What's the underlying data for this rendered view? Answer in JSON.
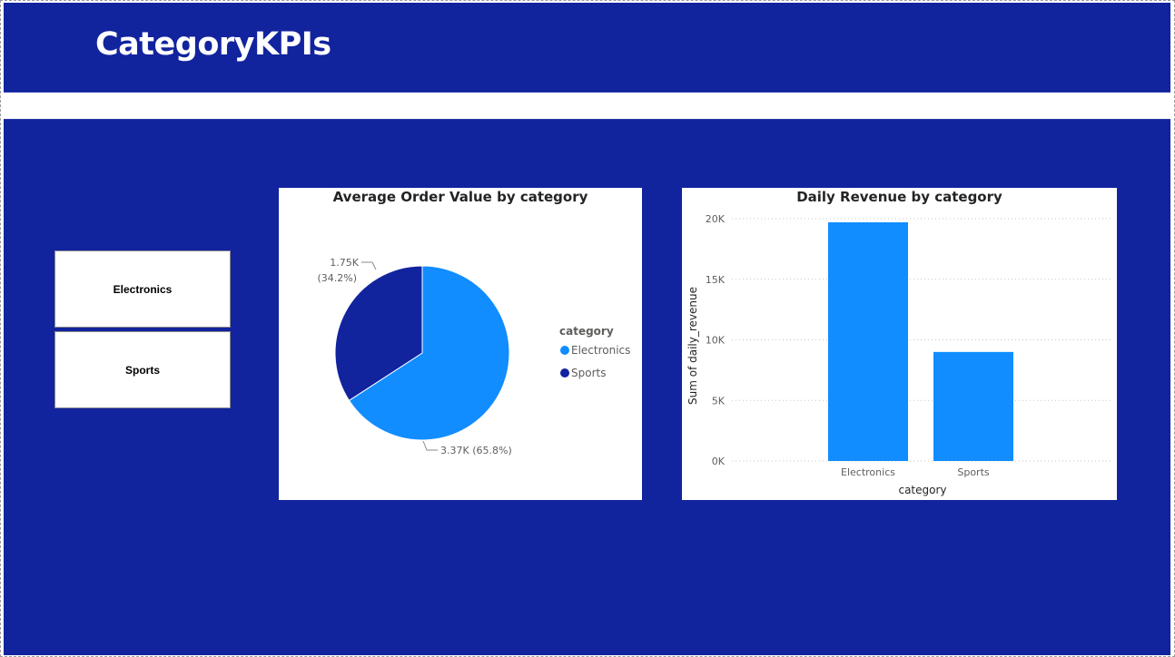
{
  "page": {
    "title": "CategoryKPIs"
  },
  "slicer": {
    "items": [
      "Electronics",
      "Sports"
    ]
  },
  "colors": {
    "background": "#12239e",
    "electronics": "#118dff",
    "sports": "#12239e"
  },
  "pie": {
    "title": "Average Order Value by category",
    "legend_title": "category",
    "legend_items": [
      "Electronics",
      "Sports"
    ],
    "electronics_label": "3.37K (65.8%)",
    "sports_label_value": "1.75K",
    "sports_label_pct": "(34.2%)"
  },
  "bar": {
    "title": "Daily Revenue by category",
    "xlabel": "category",
    "ylabel": "Sum of daily_revenue",
    "y_ticks": [
      "20K",
      "15K",
      "10K",
      "5K",
      "0K"
    ],
    "categories": [
      "Electronics",
      "Sports"
    ]
  },
  "chart_data": [
    {
      "type": "pie",
      "title": "Average Order Value by category",
      "legend_title": "category",
      "categories": [
        "Electronics",
        "Sports"
      ],
      "values": [
        3370,
        1750
      ],
      "percent": [
        65.8,
        34.2
      ]
    },
    {
      "type": "bar",
      "title": "Daily Revenue by category",
      "xlabel": "category",
      "ylabel": "Sum of daily_revenue",
      "categories": [
        "Electronics",
        "Sports"
      ],
      "values": [
        19700,
        9000
      ],
      "ylim": [
        0,
        20000
      ],
      "grid": true
    }
  ]
}
